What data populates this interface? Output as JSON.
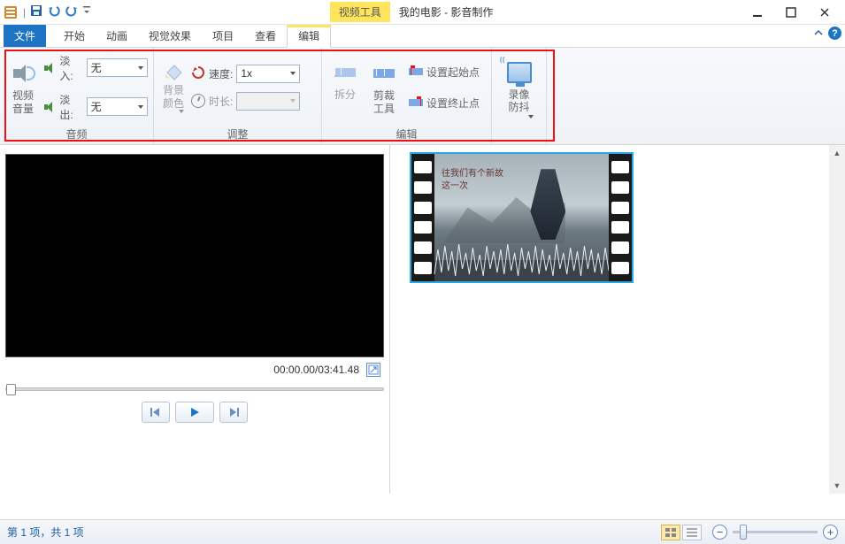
{
  "title": {
    "context_label": "视频工具",
    "app_title": "我的电影 - 影音制作"
  },
  "qat": {
    "save": "save",
    "undo": "undo",
    "redo": "redo"
  },
  "tabs": {
    "file": "文件",
    "home": "开始",
    "animations": "动画",
    "visual_effects": "视觉效果",
    "project": "项目",
    "view": "查看",
    "edit": "编辑"
  },
  "ribbon": {
    "audio": {
      "group_label": "音频",
      "video_volume": "视频\n音量",
      "fade_in_label": "淡入:",
      "fade_in_value": "无",
      "fade_out_label": "淡出:",
      "fade_out_value": "无"
    },
    "adjust": {
      "group_label": "调整",
      "bg_color": "背景\n颜色",
      "speed_label": "速度:",
      "speed_value": "1x",
      "duration_label": "时长:",
      "duration_value": ""
    },
    "editing": {
      "group_label": "编辑",
      "split": "拆分",
      "crop_tool": "剪裁\n工具",
      "set_start": "设置起始点",
      "set_end": "设置终止点",
      "stabilize": "录像\n防抖"
    }
  },
  "preview": {
    "time_current": "00:00.00",
    "time_total": "03:41.48"
  },
  "clip": {
    "line1": "往我们有个新故",
    "line2": "这一次"
  },
  "status": {
    "text": "第 1 项，共 1 项"
  }
}
